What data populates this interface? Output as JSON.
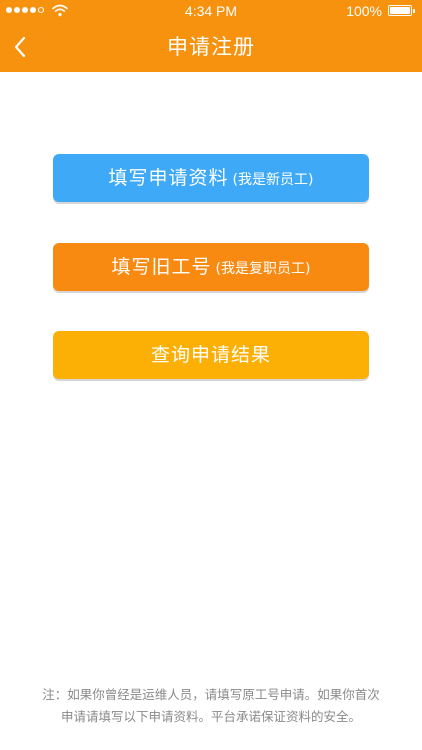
{
  "status_bar": {
    "time": "4:34 PM",
    "battery": "100%",
    "signal_bars_filled": 4,
    "signal_bars_total": 5
  },
  "header": {
    "title": "申请注册",
    "back_icon": "chevron-left-icon"
  },
  "buttons": {
    "new_employee": {
      "label": "填写申请资料",
      "sub_label": "(我是新员工)"
    },
    "old_employee": {
      "label": "填写旧工号",
      "sub_label": "(我是复职员工)"
    },
    "query": {
      "label": "查询申请结果"
    }
  },
  "note": {
    "line1": "注：如果你曾经是运维人员，请填写原工号申请。如果你首次",
    "line2": "申请请填写以下申请资料。平台承诺保证资料的安全。"
  },
  "colors": {
    "header": "#f7920e",
    "new_employee_button": "#3eaaf7",
    "old_employee_button": "#f88a12",
    "query_button": "#fcb005",
    "note_text": "#8a8a8a"
  }
}
